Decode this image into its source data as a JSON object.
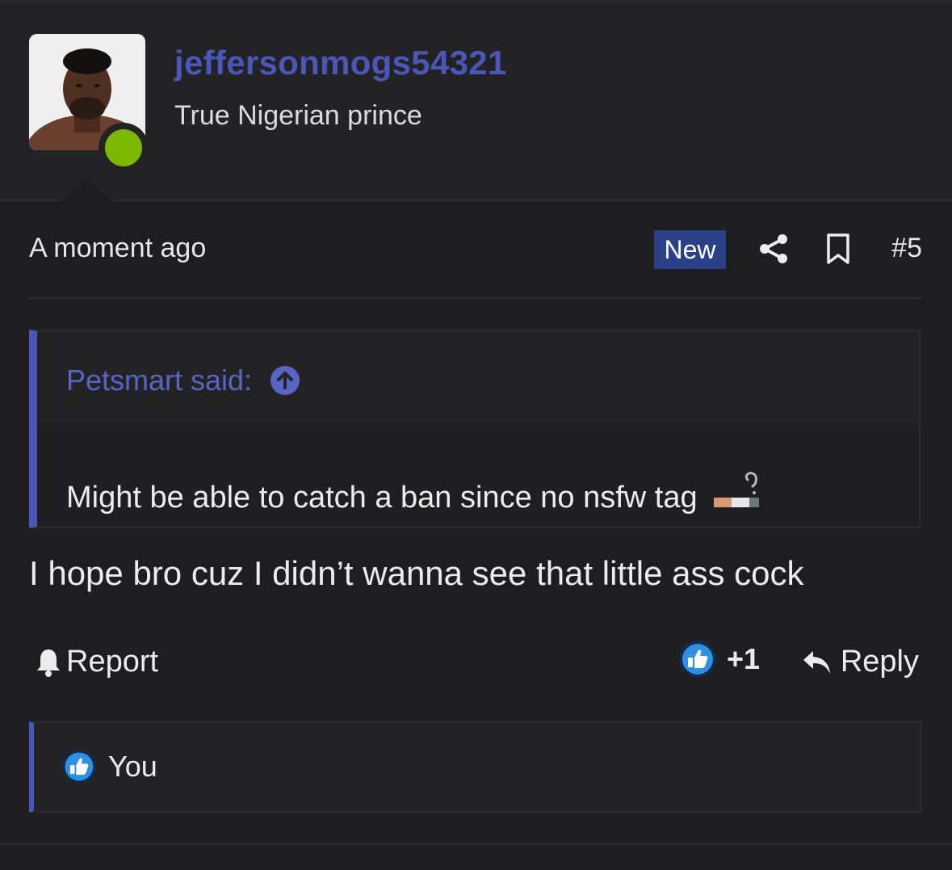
{
  "post": {
    "username": "jeffersonmogs54321",
    "user_title": "True Nigerian prince",
    "timestamp": "A moment ago",
    "badge": "New",
    "post_number": "#5",
    "quote": {
      "author_label": "Petsmart said:",
      "text": "Might be able to catch a ban since no nsfw tag"
    },
    "message": "I hope bro cuz I didn’t wanna see that little ass cock",
    "actions": {
      "report_label": "Report",
      "reaction_count": "+1",
      "reply_label": "Reply"
    },
    "reactions": {
      "reactor": "You"
    }
  },
  "colors": {
    "background": "#1e1e20",
    "username": "#4a57b8",
    "accent_bar": "#4b55b6",
    "online": "#7cb800",
    "badge_bg": "#2a418a",
    "like_icon": "#2f8fe0"
  },
  "icons": [
    "share-icon",
    "bookmark-icon",
    "arrow-up-circle-icon",
    "cigarette-emoji",
    "bell-icon",
    "like-icon",
    "reply-arrow-icon"
  ]
}
